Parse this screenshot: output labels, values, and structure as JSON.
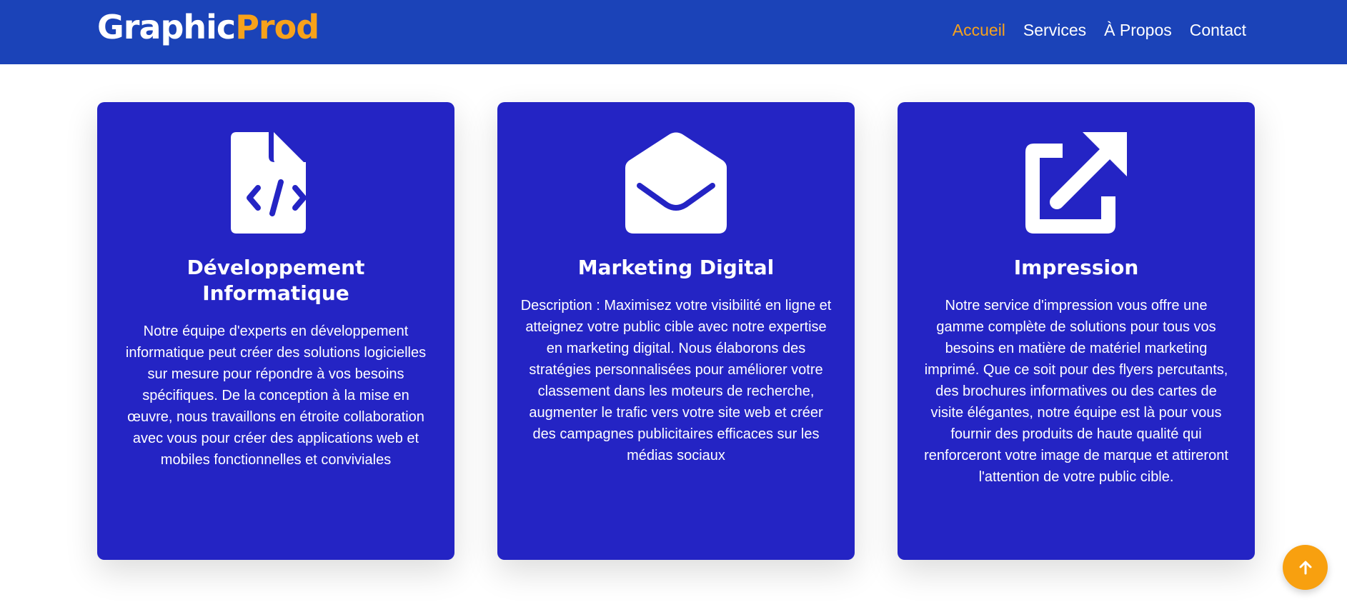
{
  "header": {
    "logo_part1": "Graphic",
    "logo_part2": "Prod",
    "nav": [
      {
        "label": "Accueil",
        "active": true
      },
      {
        "label": "Services"
      },
      {
        "label": "À Propos"
      },
      {
        "label": "Contact"
      }
    ]
  },
  "services": [
    {
      "icon": "file-code-icon",
      "title": "Développement Informatique",
      "description": "Notre équipe d'experts en développement informatique peut créer des solutions logicielles sur mesure pour répondre à vos besoins spécifiques. De la conception à la mise en œuvre, nous travaillons en étroite collaboration avec vous pour créer des applications web et mobiles fonctionnelles et conviviales"
    },
    {
      "icon": "envelope-open-icon",
      "title": "Marketing Digital",
      "description": "Description : Maximisez votre visibilité en ligne et atteignez votre public cible avec notre expertise en marketing digital. Nous élaborons des stratégies personnalisées pour améliorer votre classement dans les moteurs de recherche, augmenter le trafic vers votre site web et créer des campagnes publicitaires efficaces sur les médias sociaux"
    },
    {
      "icon": "external-link-icon",
      "title": "Impression",
      "description": "Notre service d'impression vous offre une gamme complète de solutions pour tous vos besoins en matière de matériel marketing imprimé. Que ce soit pour des flyers percutants, des brochures informatives ou des cartes de visite élégantes, notre équipe est là pour vous fournir des produits de haute qualité qui renforceront votre image de marque et attireront l'attention de votre public cible."
    }
  ],
  "back_to_top_icon": "arrow-up-icon",
  "colors": {
    "header_bg": "#1b43b8",
    "accent": "#f7a21b",
    "card_bg": "#2424c4"
  }
}
